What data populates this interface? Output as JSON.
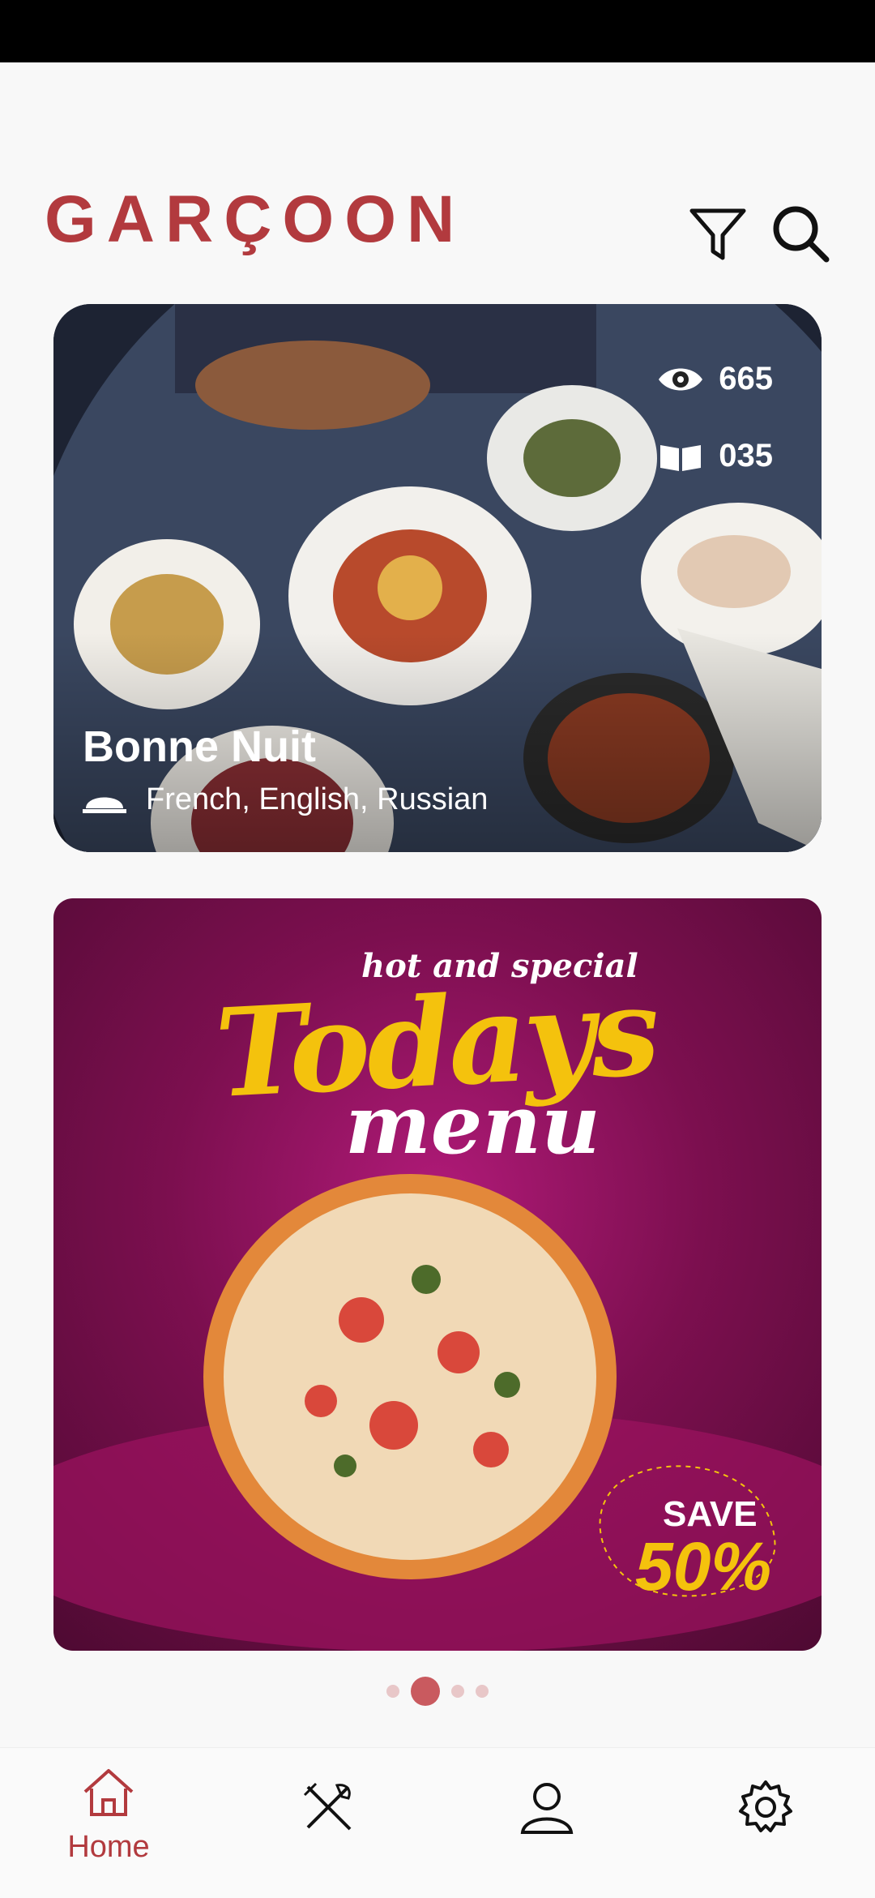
{
  "app": {
    "logo_text": "GARÇOON"
  },
  "header": {
    "filter_icon": "filter-icon",
    "search_icon": "search-icon"
  },
  "featured": {
    "name": "Bonne Nuit",
    "languages": "French, English, Russian",
    "views": "665",
    "reads": "035"
  },
  "banner": {
    "line1": "hot and special",
    "line2": "Todays",
    "line3": "menu",
    "save_label": "SAVE",
    "save_percent": "50%"
  },
  "pagination": {
    "total": 4,
    "active_index": 1
  },
  "nav": {
    "items": [
      {
        "label": "Home",
        "icon": "home-icon",
        "active": true
      },
      {
        "label": "",
        "icon": "utensils-icon",
        "active": false
      },
      {
        "label": "",
        "icon": "user-icon",
        "active": false
      },
      {
        "label": "",
        "icon": "settings-icon",
        "active": false
      }
    ]
  },
  "colors": {
    "accent": "#b23a3e",
    "banner": "#8a1256",
    "yellow": "#f4c20d"
  }
}
